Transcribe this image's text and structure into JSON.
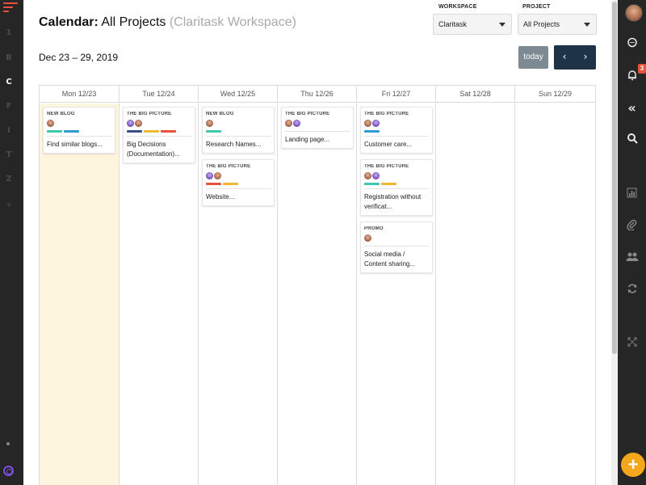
{
  "colors": {
    "accent_orange": "#e8533b",
    "fab_yellow": "#f5a71b",
    "nav_dark": "#1f3346",
    "today_gray": "#7d8a94",
    "today_highlight": "#fdf5de",
    "tag_teal": "#3ec7b0",
    "tag_blue": "#2d9bd8",
    "tag_navy": "#3a4f8a",
    "tag_yellow": "#f2b632",
    "tag_red": "#e8533b"
  },
  "left_sidebar": {
    "workspaces": [
      "1",
      "B",
      "C",
      "F",
      "I",
      "T",
      "Z"
    ],
    "active": "C",
    "add_label": "+",
    "help_icon": "lifebuoy-icon"
  },
  "right_sidebar": {
    "notification_count": "3",
    "icons": [
      "chat-icon",
      "bell-icon",
      "collapse-icon",
      "search-icon",
      "chart-icon",
      "paperclip-icon",
      "users-icon",
      "refresh-icon",
      "expand-icon"
    ],
    "fab_label": "+"
  },
  "header": {
    "title_bold": "Calendar:",
    "title_main": "All Projects",
    "title_sub": "(Claritask Workspace)",
    "date_range": "Dec 23 – 29, 2019",
    "workspace_label": "WORKSPACE",
    "workspace_value": "Claritask",
    "project_label": "PROJECT",
    "project_value": "All Projects",
    "today_label": "today",
    "prev_label": "‹",
    "next_label": "›"
  },
  "calendar": {
    "days": [
      {
        "label": "Mon 12/23",
        "today": true,
        "cards": [
          {
            "project": "NEW BLOG",
            "avatars": [
              "a"
            ],
            "tags": [
              "teal",
              "blue"
            ],
            "title": "Find similar blogs..."
          }
        ]
      },
      {
        "label": "Tue 12/24",
        "today": false,
        "cards": [
          {
            "project": "THE BIG PICTURE",
            "avatars": [
              "b",
              "a"
            ],
            "tags": [
              "navy",
              "yellow",
              "red"
            ],
            "title": "Big Decisions (Documentation)..."
          }
        ]
      },
      {
        "label": "Wed 12/25",
        "today": false,
        "cards": [
          {
            "project": "NEW BLOG",
            "avatars": [
              "a"
            ],
            "tags": [
              "teal"
            ],
            "title": "Research Names..."
          },
          {
            "project": "THE BIG PICTURE",
            "avatars": [
              "b",
              "a"
            ],
            "tags": [
              "red",
              "yellow"
            ],
            "title": "Website..."
          }
        ]
      },
      {
        "label": "Thu 12/26",
        "today": false,
        "cards": [
          {
            "project": "THE BIG PICTURE",
            "avatars": [
              "a",
              "b"
            ],
            "tags": [],
            "title": "Landing page..."
          }
        ]
      },
      {
        "label": "Fri 12/27",
        "today": false,
        "cards": [
          {
            "project": "THE BIG PICTURE",
            "avatars": [
              "a",
              "b"
            ],
            "tags": [
              "blue"
            ],
            "title": "Customer care..."
          },
          {
            "project": "THE BIG PICTURE",
            "avatars": [
              "a",
              "b"
            ],
            "tags": [
              "teal",
              "yellow"
            ],
            "title": "Registration without verificat..."
          },
          {
            "project": "PROMO",
            "avatars": [
              "a"
            ],
            "tags": [],
            "title": "Social media / Content sharing..."
          }
        ]
      },
      {
        "label": "Sat 12/28",
        "today": false,
        "cards": []
      },
      {
        "label": "Sun 12/29",
        "today": false,
        "cards": []
      }
    ]
  }
}
